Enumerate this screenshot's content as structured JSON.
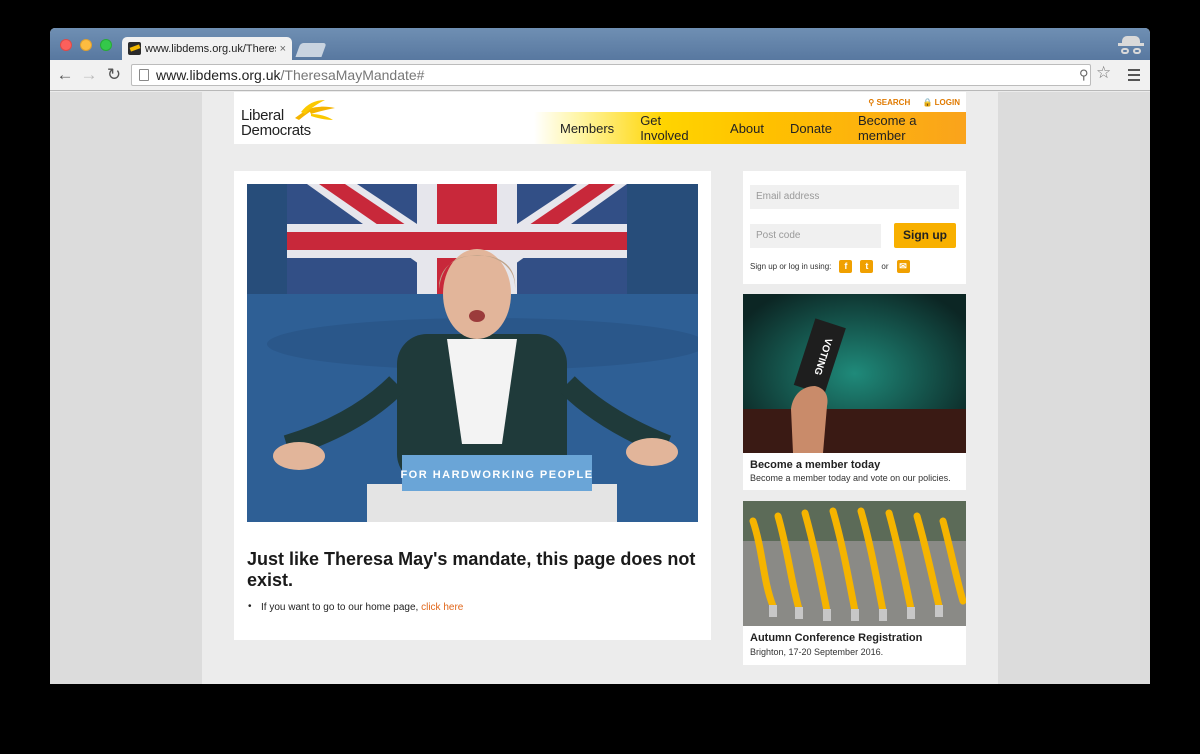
{
  "browser": {
    "tab_title": "www.libdems.org.uk/Theres",
    "tab_close": "×",
    "url_host": "www.libdems.org.uk",
    "url_path": "/TheresaMayMandate#"
  },
  "site": {
    "logo_line1": "Liberal",
    "logo_line2": "Democrats",
    "utility": {
      "search": "⚲ SEARCH",
      "login": "🔒 LOGIN"
    },
    "nav": [
      "Members",
      "Get Involved",
      "About",
      "Donate",
      "Become a member"
    ],
    "colors": {
      "accent": "#f8b000",
      "link": "#e0661a"
    }
  },
  "main": {
    "hero_banner_text": "FOR HARDWORKING PEOPLE",
    "heading": "Just like Theresa May's mandate, this page does not exist.",
    "bullet_prefix": "If you want to go to our home page, ",
    "bullet_link": "click here"
  },
  "signup": {
    "email_placeholder": "Email address",
    "postcode_placeholder": "Post code",
    "button": "Sign up",
    "social_label": "Sign up or log in using:",
    "or": "or",
    "icons": [
      "facebook-icon",
      "twitter-icon",
      "email-icon"
    ]
  },
  "promos": [
    {
      "title": "Become a member today",
      "subtitle": "Become a member today and vote on our policies.",
      "card_text": "VOTING"
    },
    {
      "title": "Autumn Conference Registration",
      "subtitle": "Brighton, 17-20 September 2016."
    }
  ]
}
